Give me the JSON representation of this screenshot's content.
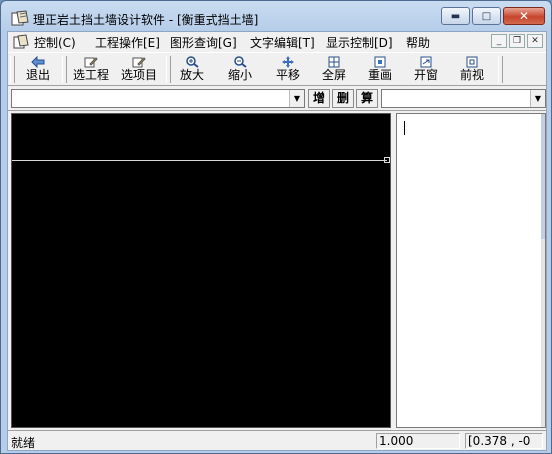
{
  "window": {
    "title": "理正岩土挡土墙设计软件 - [衡重式挡土墙]",
    "caption_buttons": [
      "minimize-icon",
      "maximize-icon",
      "close-icon"
    ]
  },
  "menu": {
    "items": [
      "控制(C)",
      "工程操作[E]",
      "图形查询[G]",
      "文字编辑[T]",
      "显示控制[D]",
      "帮助"
    ],
    "mdi_buttons": [
      "minimize-icon",
      "restore-icon",
      "close-icon"
    ]
  },
  "toolbar": {
    "buttons": [
      {
        "label": "退出",
        "icon": "arrow-left-icon"
      },
      {
        "label": "选工程",
        "icon": "edit-doc-icon"
      },
      {
        "label": "选项目",
        "icon": "edit-doc-icon"
      },
      {
        "label": "放大",
        "icon": "zoom-in-icon"
      },
      {
        "label": "缩小",
        "icon": "zoom-out-icon"
      },
      {
        "label": "平移",
        "icon": "move-icon"
      },
      {
        "label": "全屏",
        "icon": "fullscreen-icon"
      },
      {
        "label": "重画",
        "icon": "redraw-icon"
      },
      {
        "label": "开窗",
        "icon": "window-icon"
      },
      {
        "label": "前视",
        "icon": "front-view-icon"
      }
    ]
  },
  "combobar": {
    "combo_left_value": "",
    "add_label": "增",
    "delete_label": "删",
    "calc_label": "算",
    "combo_right_value": ""
  },
  "status": {
    "text": "就绪",
    "scale": "1.000",
    "coords": "[0.378 , -0"
  },
  "colors": {
    "canvas_bg": "#000000",
    "titlebar": "#c9dcf1",
    "close_button": "#c7452f"
  }
}
